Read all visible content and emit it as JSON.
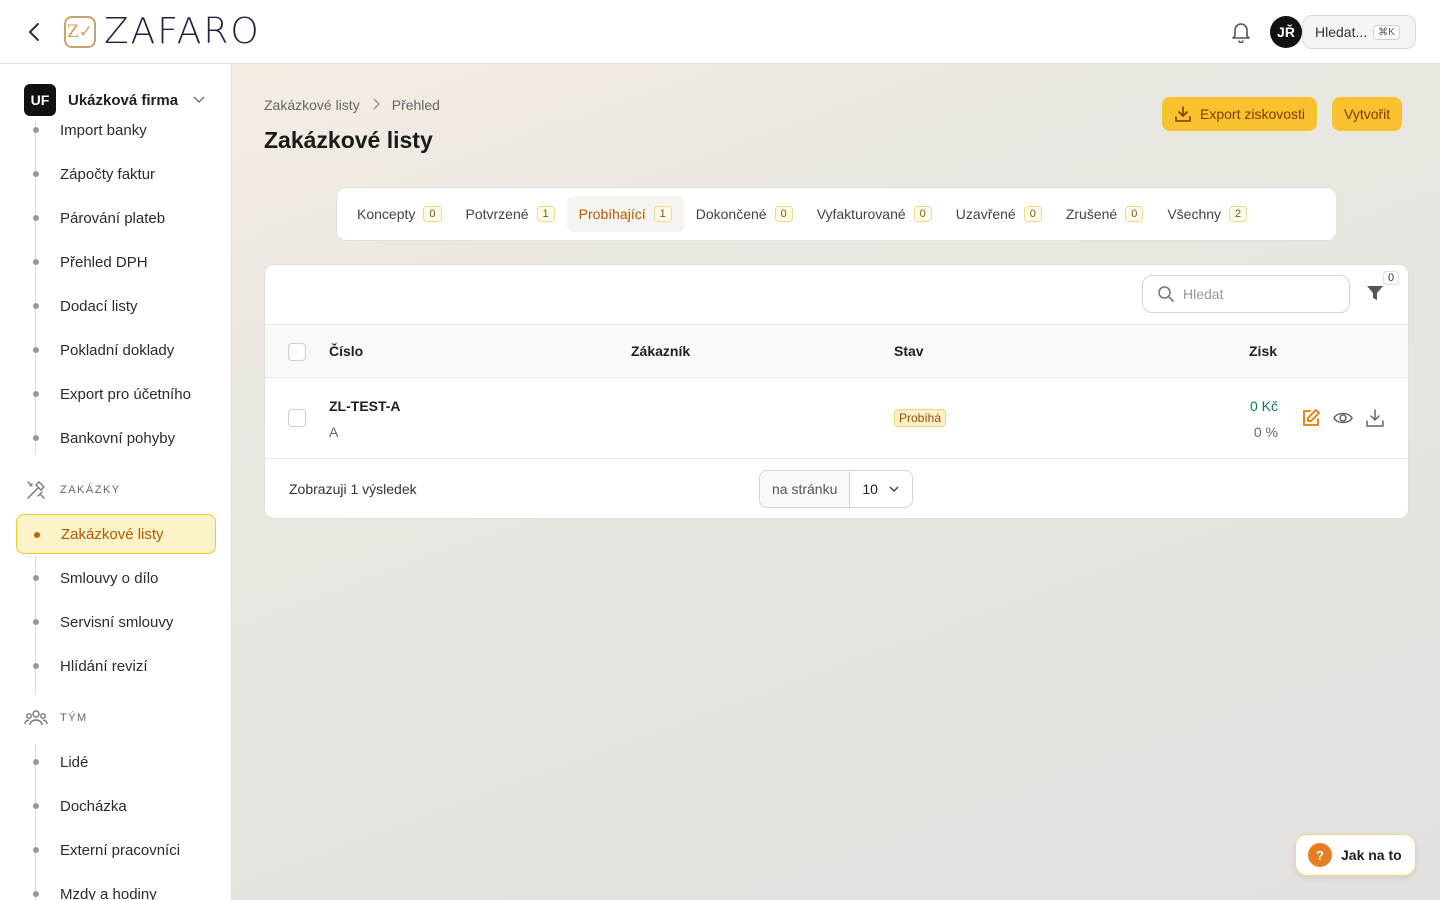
{
  "header": {
    "logo_text": "ZAFARO",
    "user_initials": "JŘ",
    "search_label": "Hledat...",
    "search_shortcut": "⌘K"
  },
  "sidebar": {
    "company_initials": "UF",
    "company_name": "Ukázková firma",
    "items_top": [
      {
        "label": "Import banky"
      },
      {
        "label": "Zápočty faktur"
      },
      {
        "label": "Párování plateb"
      },
      {
        "label": "Přehled DPH"
      },
      {
        "label": "Dodací listy"
      },
      {
        "label": "Pokladní doklady"
      },
      {
        "label": "Export pro účetního"
      },
      {
        "label": "Bankovní pohyby"
      }
    ],
    "section_zakazky": "ZAKÁZKY",
    "items_zakazky": [
      {
        "label": "Zakázkové listy"
      },
      {
        "label": "Smlouvy o dílo"
      },
      {
        "label": "Servisní smlouvy"
      },
      {
        "label": "Hlídání revizí"
      }
    ],
    "section_tym": "TÝM",
    "items_tym": [
      {
        "label": "Lidé"
      },
      {
        "label": "Docházka"
      },
      {
        "label": "Externí pracovníci"
      },
      {
        "label": "Mzdy a hodiny"
      }
    ]
  },
  "main": {
    "breadcrumb": [
      "Zakázkové listy",
      "Přehled"
    ],
    "title": "Zakázkové listy",
    "export_label": "Export ziskovosti",
    "create_label": "Vytvořit",
    "tabs": [
      {
        "label": "Koncepty",
        "count": "0"
      },
      {
        "label": "Potvrzené",
        "count": "1"
      },
      {
        "label": "Probíhající",
        "count": "1"
      },
      {
        "label": "Dokončené",
        "count": "0"
      },
      {
        "label": "Vyfakturované",
        "count": "0"
      },
      {
        "label": "Uzavřené",
        "count": "0"
      },
      {
        "label": "Zrušené",
        "count": "0"
      },
      {
        "label": "Všechny",
        "count": "2"
      }
    ],
    "active_tab": "Probíhající",
    "search_placeholder": "Hledat",
    "filter_count": "0",
    "columns": {
      "number": "Číslo",
      "customer": "Zákazník",
      "status": "Stav",
      "profit": "Zisk"
    },
    "rows": [
      {
        "number": "ZL-TEST-A",
        "sub": "A",
        "customer": "",
        "status": "Probíhá",
        "profit": "0 Kč",
        "profit_pct": "0 %"
      }
    ],
    "results_text": "Zobrazuji 1 výsledek",
    "per_page_label": "na stránku",
    "per_page_value": "10"
  },
  "help": {
    "label": "Jak na to",
    "icon": "?"
  },
  "colors": {
    "accent": "#f9c22e",
    "active_text": "#b35a00",
    "profit_green": "#0f7a52"
  }
}
